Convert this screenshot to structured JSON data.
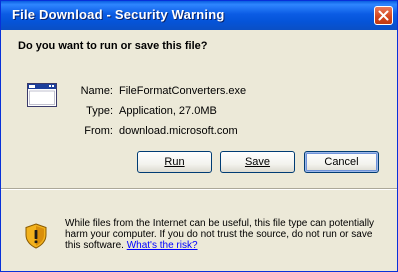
{
  "window": {
    "title": "File Download - Security Warning"
  },
  "prompt": {
    "question": "Do you want to run or save this file?"
  },
  "file": {
    "icon": "application-window-icon",
    "name_label": "Name:",
    "name_value": "FileFormatConverters.exe",
    "type_label": "Type:",
    "type_value": "Application, 27.0MB",
    "from_label": "From:",
    "from_value": "download.microsoft.com"
  },
  "buttons": {
    "run": "Run",
    "save": "Save",
    "cancel": "Cancel"
  },
  "warning": {
    "icon": "shield-warning-icon",
    "text": "While files from the Internet can be useful, this file type can potentially harm your computer. If you do not trust the source, do not run or save this software.",
    "link": "What's the risk?"
  },
  "colors": {
    "title_bar": "#0554d9",
    "dialog_bg": "#ece9d8",
    "close_button": "#d3441c",
    "link": "#0000ff"
  }
}
